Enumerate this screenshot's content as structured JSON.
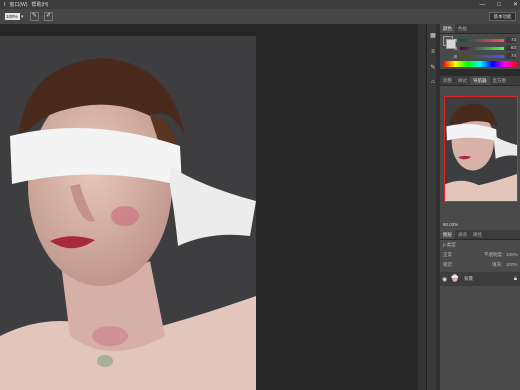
{
  "menubar": {
    "items": [
      "t",
      "窗口(W)",
      "帮助(H)"
    ],
    "controls": [
      "—",
      "□",
      "✕"
    ]
  },
  "options": {
    "zoom": "100%",
    "zoom_arrow": "▾",
    "workspace": "基本功能"
  },
  "color_panel": {
    "tabs": [
      "颜色",
      "色板"
    ],
    "sliders": [
      {
        "label": "R",
        "value": "73"
      },
      {
        "label": "G",
        "value": "83"
      },
      {
        "label": "B",
        "value": "74"
      }
    ]
  },
  "navigator_panel": {
    "tabs": [
      "调整",
      "样式",
      "导航器",
      "直方图"
    ],
    "zoom": "50.02%"
  },
  "layers_panel": {
    "tabs": [
      "图层",
      "通道",
      "路径"
    ],
    "kind": "ρ 类型",
    "blend_mode": "正常",
    "opacity_label": "不透明度:",
    "opacity": "100%",
    "lock_label": "锁定:",
    "fill_label": "填充:",
    "fill": "100%",
    "layer_name": "背景"
  },
  "colors": {
    "accent_red": "#d22222",
    "panel": "#4a4a4a",
    "canvas": "#262626"
  }
}
